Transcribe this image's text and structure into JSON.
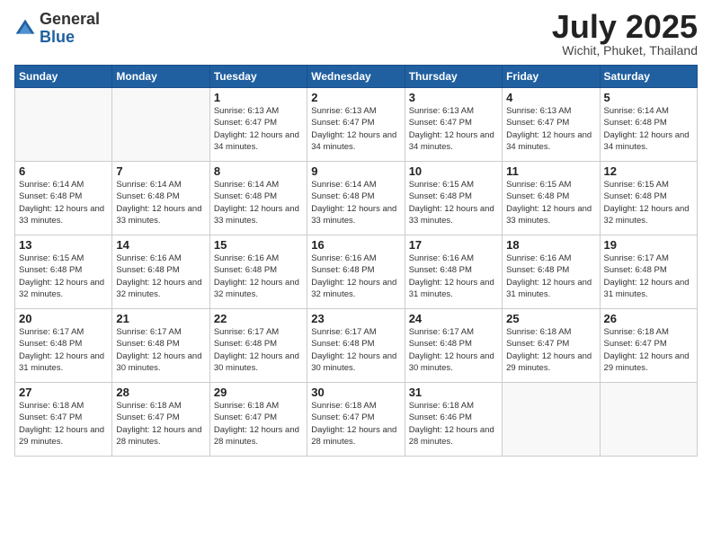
{
  "header": {
    "logo_general": "General",
    "logo_blue": "Blue",
    "month_title": "July 2025",
    "location": "Wichit, Phuket, Thailand"
  },
  "weekdays": [
    "Sunday",
    "Monday",
    "Tuesday",
    "Wednesday",
    "Thursday",
    "Friday",
    "Saturday"
  ],
  "weeks": [
    [
      {
        "day": "",
        "sunrise": "",
        "sunset": "",
        "daylight": ""
      },
      {
        "day": "",
        "sunrise": "",
        "sunset": "",
        "daylight": ""
      },
      {
        "day": "1",
        "sunrise": "Sunrise: 6:13 AM",
        "sunset": "Sunset: 6:47 PM",
        "daylight": "Daylight: 12 hours and 34 minutes."
      },
      {
        "day": "2",
        "sunrise": "Sunrise: 6:13 AM",
        "sunset": "Sunset: 6:47 PM",
        "daylight": "Daylight: 12 hours and 34 minutes."
      },
      {
        "day": "3",
        "sunrise": "Sunrise: 6:13 AM",
        "sunset": "Sunset: 6:47 PM",
        "daylight": "Daylight: 12 hours and 34 minutes."
      },
      {
        "day": "4",
        "sunrise": "Sunrise: 6:13 AM",
        "sunset": "Sunset: 6:47 PM",
        "daylight": "Daylight: 12 hours and 34 minutes."
      },
      {
        "day": "5",
        "sunrise": "Sunrise: 6:14 AM",
        "sunset": "Sunset: 6:48 PM",
        "daylight": "Daylight: 12 hours and 34 minutes."
      }
    ],
    [
      {
        "day": "6",
        "sunrise": "Sunrise: 6:14 AM",
        "sunset": "Sunset: 6:48 PM",
        "daylight": "Daylight: 12 hours and 33 minutes."
      },
      {
        "day": "7",
        "sunrise": "Sunrise: 6:14 AM",
        "sunset": "Sunset: 6:48 PM",
        "daylight": "Daylight: 12 hours and 33 minutes."
      },
      {
        "day": "8",
        "sunrise": "Sunrise: 6:14 AM",
        "sunset": "Sunset: 6:48 PM",
        "daylight": "Daylight: 12 hours and 33 minutes."
      },
      {
        "day": "9",
        "sunrise": "Sunrise: 6:14 AM",
        "sunset": "Sunset: 6:48 PM",
        "daylight": "Daylight: 12 hours and 33 minutes."
      },
      {
        "day": "10",
        "sunrise": "Sunrise: 6:15 AM",
        "sunset": "Sunset: 6:48 PM",
        "daylight": "Daylight: 12 hours and 33 minutes."
      },
      {
        "day": "11",
        "sunrise": "Sunrise: 6:15 AM",
        "sunset": "Sunset: 6:48 PM",
        "daylight": "Daylight: 12 hours and 33 minutes."
      },
      {
        "day": "12",
        "sunrise": "Sunrise: 6:15 AM",
        "sunset": "Sunset: 6:48 PM",
        "daylight": "Daylight: 12 hours and 32 minutes."
      }
    ],
    [
      {
        "day": "13",
        "sunrise": "Sunrise: 6:15 AM",
        "sunset": "Sunset: 6:48 PM",
        "daylight": "Daylight: 12 hours and 32 minutes."
      },
      {
        "day": "14",
        "sunrise": "Sunrise: 6:16 AM",
        "sunset": "Sunset: 6:48 PM",
        "daylight": "Daylight: 12 hours and 32 minutes."
      },
      {
        "day": "15",
        "sunrise": "Sunrise: 6:16 AM",
        "sunset": "Sunset: 6:48 PM",
        "daylight": "Daylight: 12 hours and 32 minutes."
      },
      {
        "day": "16",
        "sunrise": "Sunrise: 6:16 AM",
        "sunset": "Sunset: 6:48 PM",
        "daylight": "Daylight: 12 hours and 32 minutes."
      },
      {
        "day": "17",
        "sunrise": "Sunrise: 6:16 AM",
        "sunset": "Sunset: 6:48 PM",
        "daylight": "Daylight: 12 hours and 31 minutes."
      },
      {
        "day": "18",
        "sunrise": "Sunrise: 6:16 AM",
        "sunset": "Sunset: 6:48 PM",
        "daylight": "Daylight: 12 hours and 31 minutes."
      },
      {
        "day": "19",
        "sunrise": "Sunrise: 6:17 AM",
        "sunset": "Sunset: 6:48 PM",
        "daylight": "Daylight: 12 hours and 31 minutes."
      }
    ],
    [
      {
        "day": "20",
        "sunrise": "Sunrise: 6:17 AM",
        "sunset": "Sunset: 6:48 PM",
        "daylight": "Daylight: 12 hours and 31 minutes."
      },
      {
        "day": "21",
        "sunrise": "Sunrise: 6:17 AM",
        "sunset": "Sunset: 6:48 PM",
        "daylight": "Daylight: 12 hours and 30 minutes."
      },
      {
        "day": "22",
        "sunrise": "Sunrise: 6:17 AM",
        "sunset": "Sunset: 6:48 PM",
        "daylight": "Daylight: 12 hours and 30 minutes."
      },
      {
        "day": "23",
        "sunrise": "Sunrise: 6:17 AM",
        "sunset": "Sunset: 6:48 PM",
        "daylight": "Daylight: 12 hours and 30 minutes."
      },
      {
        "day": "24",
        "sunrise": "Sunrise: 6:17 AM",
        "sunset": "Sunset: 6:48 PM",
        "daylight": "Daylight: 12 hours and 30 minutes."
      },
      {
        "day": "25",
        "sunrise": "Sunrise: 6:18 AM",
        "sunset": "Sunset: 6:47 PM",
        "daylight": "Daylight: 12 hours and 29 minutes."
      },
      {
        "day": "26",
        "sunrise": "Sunrise: 6:18 AM",
        "sunset": "Sunset: 6:47 PM",
        "daylight": "Daylight: 12 hours and 29 minutes."
      }
    ],
    [
      {
        "day": "27",
        "sunrise": "Sunrise: 6:18 AM",
        "sunset": "Sunset: 6:47 PM",
        "daylight": "Daylight: 12 hours and 29 minutes."
      },
      {
        "day": "28",
        "sunrise": "Sunrise: 6:18 AM",
        "sunset": "Sunset: 6:47 PM",
        "daylight": "Daylight: 12 hours and 28 minutes."
      },
      {
        "day": "29",
        "sunrise": "Sunrise: 6:18 AM",
        "sunset": "Sunset: 6:47 PM",
        "daylight": "Daylight: 12 hours and 28 minutes."
      },
      {
        "day": "30",
        "sunrise": "Sunrise: 6:18 AM",
        "sunset": "Sunset: 6:47 PM",
        "daylight": "Daylight: 12 hours and 28 minutes."
      },
      {
        "day": "31",
        "sunrise": "Sunrise: 6:18 AM",
        "sunset": "Sunset: 6:46 PM",
        "daylight": "Daylight: 12 hours and 28 minutes."
      },
      {
        "day": "",
        "sunrise": "",
        "sunset": "",
        "daylight": ""
      },
      {
        "day": "",
        "sunrise": "",
        "sunset": "",
        "daylight": ""
      }
    ]
  ]
}
